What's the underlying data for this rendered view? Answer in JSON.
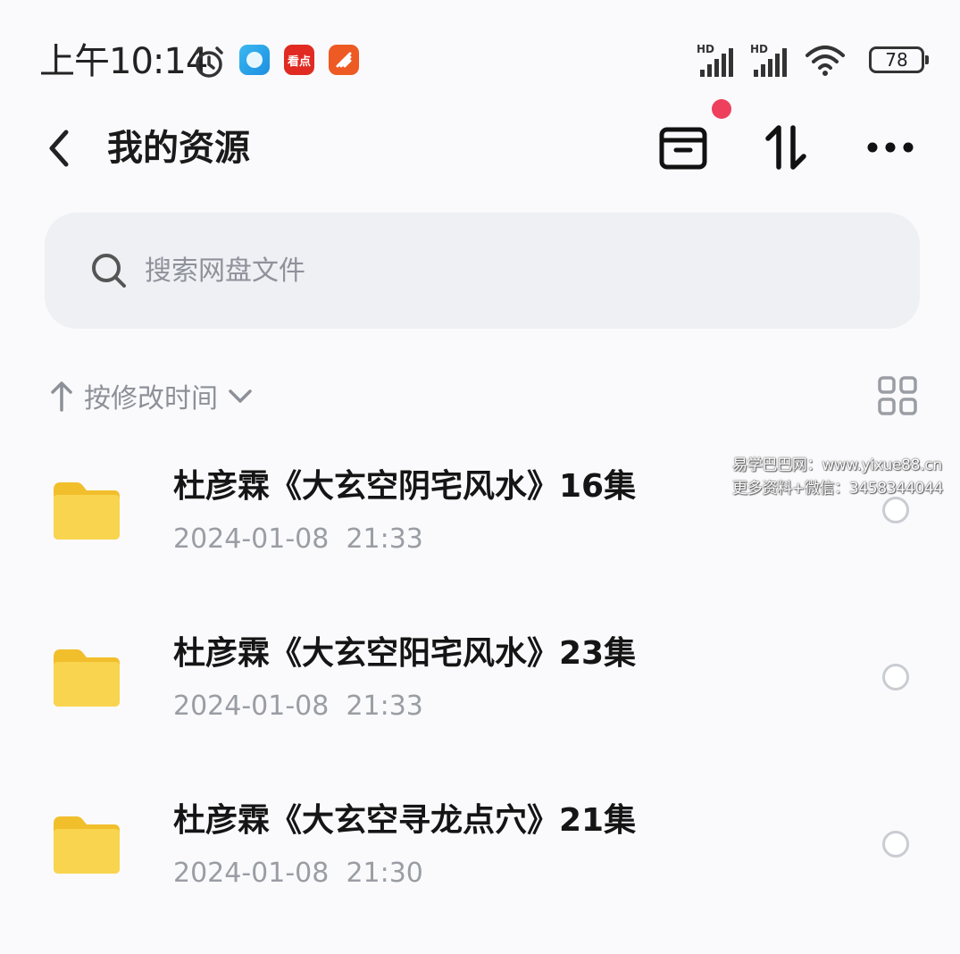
{
  "status_bar": {
    "time": "上午10:14",
    "kandian_label": "看点",
    "signal_1_label": "HD",
    "signal_2_label": "HD",
    "battery": "78"
  },
  "header": {
    "title": "我的资源"
  },
  "search": {
    "placeholder": "搜索网盘文件"
  },
  "sort": {
    "label": "按修改时间"
  },
  "files": [
    {
      "name": "杜彦霖《大玄空阴宅风水》16集",
      "date": "2024-01-08",
      "time": "21:33"
    },
    {
      "name": "杜彦霖《大玄空阳宅风水》23集",
      "date": "2024-01-08",
      "time": "21:33"
    },
    {
      "name": "杜彦霖《大玄空寻龙点穴》21集",
      "date": "2024-01-08",
      "time": "21:30"
    }
  ],
  "watermark": {
    "line1": "易学巴巴网：www.yixue88.cn",
    "line2": "更多资料+微信：3458344044"
  },
  "colors": {
    "notify_dot": "#ee3f5c",
    "folder": "#f7cb3e",
    "secondary_text": "#9a9da4"
  }
}
